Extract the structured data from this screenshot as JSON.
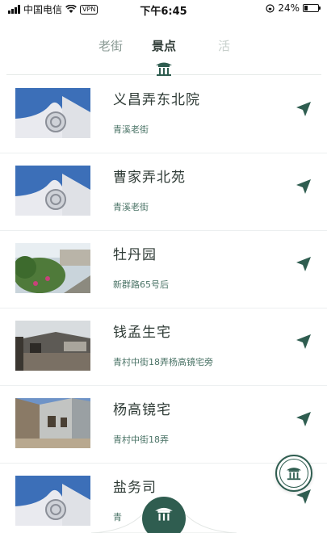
{
  "status_bar": {
    "carrier": "中国电信",
    "vpn": "VPN",
    "time": "下午6:45",
    "battery": "24%",
    "battery_level": 0.24
  },
  "tabs": [
    {
      "label": "老街",
      "active": false
    },
    {
      "label": "景点",
      "active": true
    },
    {
      "label": "活",
      "active": false
    }
  ],
  "list": {
    "items": [
      {
        "title": "义昌弄东北院",
        "subtitle": "青溪老街",
        "thumb": "gate-sky"
      },
      {
        "title": "曹家弄北苑",
        "subtitle": "青溪老街",
        "thumb": "gate-sky"
      },
      {
        "title": "牡丹园",
        "subtitle": "新群路65号后",
        "thumb": "garden"
      },
      {
        "title": "钱孟生宅",
        "subtitle": "青村中街18弄杨高镜宅旁",
        "thumb": "old-house"
      },
      {
        "title": "杨高镜宅",
        "subtitle": "青村中街18弄",
        "thumb": "alley"
      },
      {
        "title": "盐务司",
        "subtitle": "青",
        "thumb": "gate-sky"
      }
    ]
  },
  "colors": {
    "accent": "#2f5d50",
    "subtitle": "#4a7366"
  },
  "icons": {
    "tab_indicator": "pavilion-icon",
    "nav": "navigate-arrow-icon",
    "float_button": "pavilion-icon",
    "bottom_center": "pavilion-icon"
  }
}
